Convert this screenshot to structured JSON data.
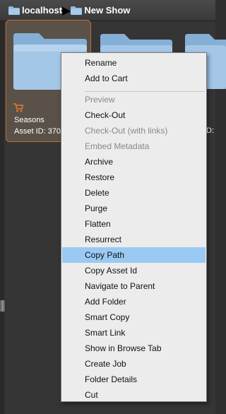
{
  "breadcrumb": {
    "items": [
      "localhost",
      "New Show"
    ]
  },
  "cards": [
    {
      "name": "Seasons",
      "asset_id": "Asset ID: 370",
      "selected": true
    },
    {
      "name": "",
      "asset_id": "D:",
      "selected": false
    }
  ],
  "context_menu": {
    "items": [
      {
        "label": "Rename",
        "state": "enabled"
      },
      {
        "label": "Add to Cart",
        "state": "enabled"
      },
      {
        "label": "Preview",
        "state": "disabled"
      },
      {
        "label": "Check-Out",
        "state": "enabled"
      },
      {
        "label": "Check-Out (with links)",
        "state": "disabled"
      },
      {
        "label": "Embed Metadata",
        "state": "disabled"
      },
      {
        "label": "Archive",
        "state": "enabled"
      },
      {
        "label": "Restore",
        "state": "enabled"
      },
      {
        "label": "Delete",
        "state": "enabled"
      },
      {
        "label": "Purge",
        "state": "enabled"
      },
      {
        "label": "Flatten",
        "state": "enabled"
      },
      {
        "label": "Resurrect",
        "state": "enabled"
      },
      {
        "label": "Copy Path",
        "state": "highlighted"
      },
      {
        "label": "Copy Asset Id",
        "state": "enabled"
      },
      {
        "label": "Navigate to Parent",
        "state": "enabled"
      },
      {
        "label": "Add Folder",
        "state": "enabled"
      },
      {
        "label": "Smart Copy",
        "state": "enabled"
      },
      {
        "label": "Smart Link",
        "state": "enabled"
      },
      {
        "label": "Show in Browse Tab",
        "state": "enabled"
      },
      {
        "label": "Create Job",
        "state": "enabled"
      },
      {
        "label": "Folder Details",
        "state": "enabled"
      },
      {
        "label": "Cut",
        "state": "enabled"
      }
    ]
  },
  "colors": {
    "folder": "#9fc3e4",
    "selection_border": "#c46d2a",
    "menu_highlight": "#9ac9f3",
    "cart": "#e07b2a"
  },
  "icons": {
    "breadcrumb_folder": "folder-icon",
    "breadcrumb_separator": "chevron-right-icon",
    "cart": "cart-icon",
    "card_folder": "folder-icon"
  }
}
